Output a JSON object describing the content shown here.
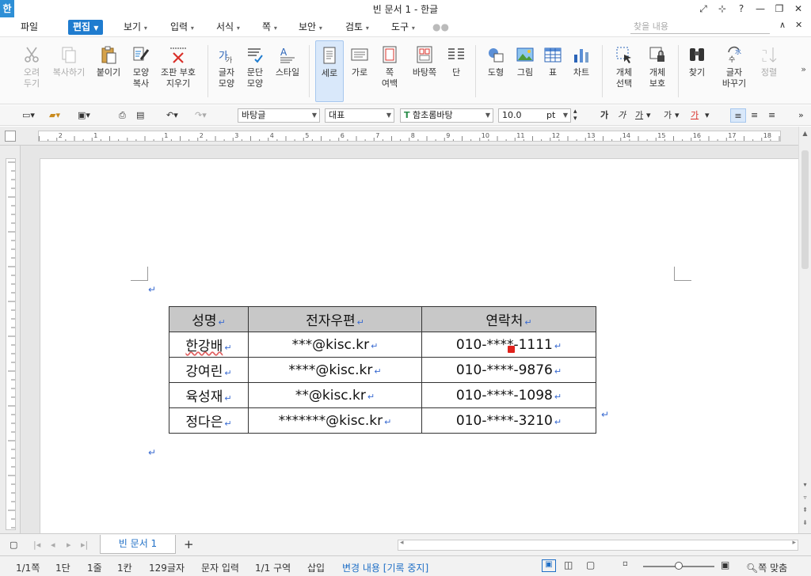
{
  "window": {
    "logo": "한",
    "title": "빈 문서 1 - 한글",
    "controls": [
      "⤢",
      "⊹",
      "?",
      "—",
      "❐",
      "✕"
    ]
  },
  "menu": {
    "items": [
      "파일",
      "편집",
      "보기",
      "입력",
      "서식",
      "쪽",
      "보안",
      "검토",
      "도구"
    ],
    "active_index": 1,
    "search_placeholder": "찾을 내용",
    "right_controls": [
      "∧",
      "✕"
    ]
  },
  "ribbon": {
    "buttons": [
      {
        "label": "오려\n두기",
        "icon": "scissors-icon",
        "disabled": true
      },
      {
        "label": "복사하기",
        "icon": "copy-icon",
        "disabled": true
      },
      {
        "label": "붙이기",
        "icon": "paste-icon"
      },
      {
        "label": "모양\n복사",
        "icon": "format-painter-icon"
      },
      {
        "label": "조판 부호\n지우기",
        "icon": "clear-markup-icon"
      },
      {
        "label": "글자\n모양",
        "icon": "char-shape-icon"
      },
      {
        "label": "문단\n모양",
        "icon": "para-shape-icon"
      },
      {
        "label": "스타일",
        "icon": "style-icon"
      },
      {
        "label": "세로",
        "icon": "portrait-icon",
        "selected": true
      },
      {
        "label": "가로",
        "icon": "landscape-icon"
      },
      {
        "label": "쪽\n여백",
        "icon": "page-margin-icon"
      },
      {
        "label": "바탕쪽",
        "icon": "master-page-icon"
      },
      {
        "label": "단",
        "icon": "columns-icon"
      },
      {
        "label": "도형",
        "icon": "shape-icon"
      },
      {
        "label": "그림",
        "icon": "picture-icon"
      },
      {
        "label": "표",
        "icon": "table-icon"
      },
      {
        "label": "차트",
        "icon": "chart-icon"
      },
      {
        "label": "개체\n선택",
        "icon": "object-select-icon"
      },
      {
        "label": "개체\n보호",
        "icon": "object-protect-icon"
      },
      {
        "label": "찾기",
        "icon": "binoculars-icon"
      },
      {
        "label": "글자\n바꾸기",
        "icon": "replace-icon"
      },
      {
        "label": "정렬",
        "icon": "sort-icon",
        "disabled": true
      }
    ]
  },
  "toolbar": {
    "style": "바탕글",
    "lang": "대표",
    "font": "함초롬바탕",
    "size": "10.0",
    "unit": "pt",
    "char_buttons": [
      "가",
      "가",
      "가",
      "가",
      "가"
    ],
    "font_icon": "T"
  },
  "ruler": {
    "labels": [
      "2",
      "1",
      "1",
      "2",
      "3",
      "4",
      "5",
      "6",
      "7",
      "8",
      "9",
      "10",
      "11",
      "12",
      "13",
      "14",
      "15",
      "16",
      "17",
      "18"
    ]
  },
  "table": {
    "headers": [
      "성명",
      "전자우편",
      "연락처"
    ],
    "rows": [
      [
        "한강배",
        "***@kisc.kr",
        "010-****-1111"
      ],
      [
        "강여린",
        "****@kisc.kr",
        "010-****-9876"
      ],
      [
        "육성재",
        "**@kisc.kr",
        "010-****-1098"
      ],
      [
        "정다은",
        "*******@kisc.kr",
        "010-****-3210"
      ]
    ],
    "para_mark": "↵"
  },
  "tabs": {
    "doc_tab": "빈 문서 1",
    "add": "+"
  },
  "status": {
    "page": "1/1쪽",
    "column": "1단",
    "line": "1줄",
    "cell": "1칸",
    "chars": "129글자",
    "mode": "문자 입력",
    "section": "1/1 구역",
    "insert": "삽입",
    "track": "변경 내용 [기록 중지]",
    "zoom": "쪽 맞춤"
  }
}
